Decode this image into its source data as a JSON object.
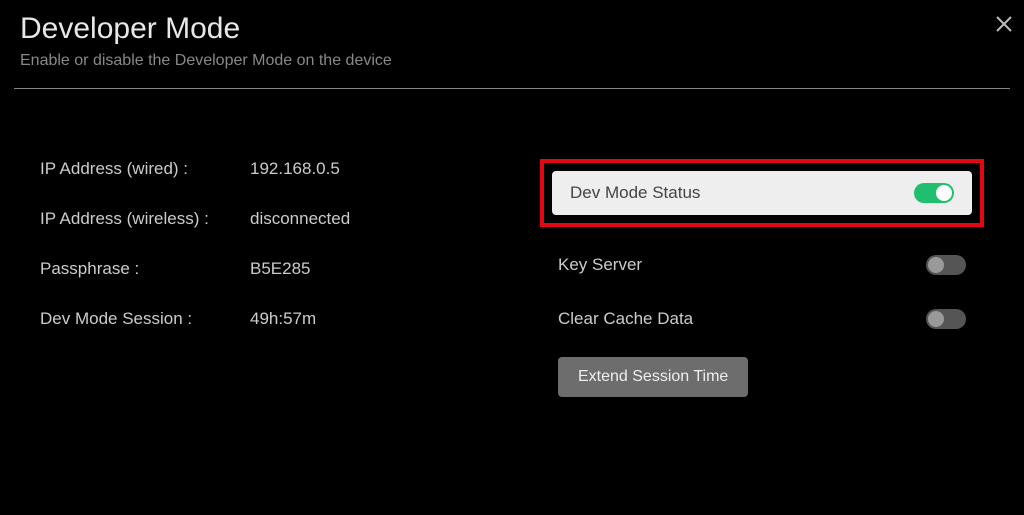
{
  "header": {
    "title": "Developer Mode",
    "subtitle": "Enable or disable the Developer Mode on the device"
  },
  "info": {
    "ip_wired_label": "IP Address (wired) :",
    "ip_wired_value": "192.168.0.5",
    "ip_wireless_label": "IP Address (wireless) :",
    "ip_wireless_value": "disconnected",
    "passphrase_label": "Passphrase :",
    "passphrase_value": "B5E285",
    "session_label": "Dev Mode Session :",
    "session_value": "49h:57m"
  },
  "toggles": {
    "dev_mode_label": "Dev Mode Status",
    "key_server_label": "Key Server",
    "clear_cache_label": "Clear Cache Data"
  },
  "buttons": {
    "extend_label": "Extend Session Time"
  }
}
